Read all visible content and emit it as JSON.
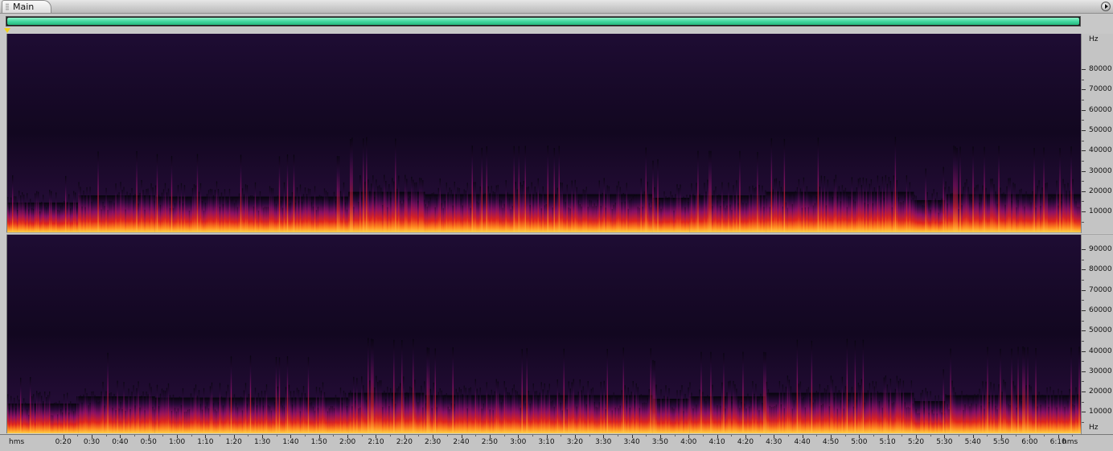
{
  "panel": {
    "tab_label": "Main"
  },
  "overview": {
    "fill_fraction": 1.0,
    "color": "#3fd79e"
  },
  "colors": {
    "background": "#06040c",
    "low": "#2a0a3a",
    "mid": "#8a1066",
    "high": "#e0241c",
    "peak": "#ffd04a"
  },
  "channels": [
    {
      "hz_unit": "Hz",
      "hz_labels": [
        "80000",
        "70000",
        "60000",
        "50000",
        "40000",
        "30000",
        "20000",
        "10000"
      ]
    },
    {
      "hz_unit": "Hz",
      "hz_labels": [
        "90000",
        "80000",
        "70000",
        "60000",
        "50000",
        "40000",
        "30000",
        "20000",
        "10000"
      ]
    }
  ],
  "timeline": {
    "unit_left": "hms",
    "unit_right": "hms",
    "labels": [
      "0:20",
      "0:30",
      "0:40",
      "0:50",
      "1:00",
      "1:10",
      "1:20",
      "1:30",
      "1:40",
      "1:50",
      "2:00",
      "2:10",
      "2:20",
      "2:30",
      "2:40",
      "2:50",
      "3:00",
      "3:10",
      "3:20",
      "3:30",
      "3:40",
      "3:50",
      "4:00",
      "4:10",
      "4:20",
      "4:30",
      "4:40",
      "4:50",
      "5:00",
      "5:10",
      "5:20",
      "5:30",
      "5:40",
      "5:50",
      "6:00",
      "6:10"
    ]
  },
  "chart_data": {
    "type": "heatmap",
    "x_unit": "hms",
    "y_unit": "Hz",
    "segments": [
      {
        "start": "0:00",
        "end": "0:25",
        "level": 0.25
      },
      {
        "start": "0:25",
        "end": "0:52",
        "level": 0.55
      },
      {
        "start": "0:52",
        "end": "2:00",
        "level": 0.5
      },
      {
        "start": "2:00",
        "end": "2:27",
        "level": 0.7
      },
      {
        "start": "2:27",
        "end": "3:47",
        "level": 0.6
      },
      {
        "start": "3:47",
        "end": "4:00",
        "level": 0.45
      },
      {
        "start": "4:00",
        "end": "4:27",
        "level": 0.55
      },
      {
        "start": "4:27",
        "end": "5:19",
        "level": 0.7
      },
      {
        "start": "5:19",
        "end": "5:30",
        "level": 0.35
      },
      {
        "start": "5:30",
        "end": "6:18",
        "level": 0.6
      }
    ]
  }
}
